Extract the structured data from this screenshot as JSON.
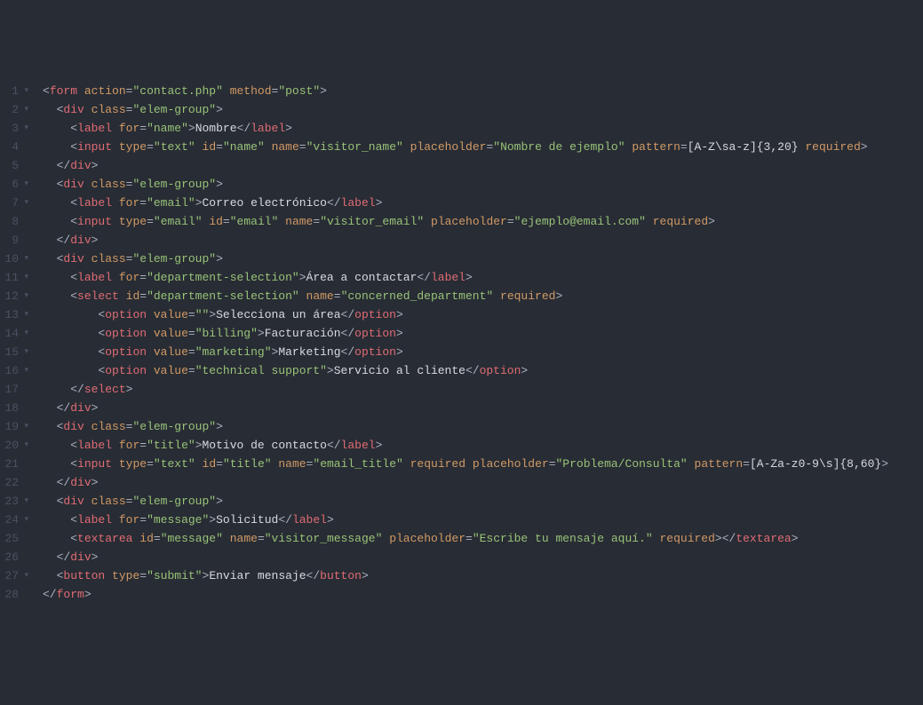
{
  "lines": [
    {
      "n": "1",
      "fold": true,
      "indent": 0,
      "tokens": [
        [
          "p",
          "<"
        ],
        [
          "t",
          "form"
        ],
        [
          "p",
          " "
        ],
        [
          "a",
          "action"
        ],
        [
          "p",
          "="
        ],
        [
          "s",
          "\"contact.php\""
        ],
        [
          "p",
          " "
        ],
        [
          "a",
          "method"
        ],
        [
          "p",
          "="
        ],
        [
          "s",
          "\"post\""
        ],
        [
          "p",
          ">"
        ]
      ]
    },
    {
      "n": "2",
      "fold": true,
      "indent": 1,
      "tokens": [
        [
          "p",
          "<"
        ],
        [
          "t",
          "div"
        ],
        [
          "p",
          " "
        ],
        [
          "a",
          "class"
        ],
        [
          "p",
          "="
        ],
        [
          "s",
          "\"elem-group\""
        ],
        [
          "p",
          ">"
        ]
      ]
    },
    {
      "n": "3",
      "fold": true,
      "indent": 2,
      "tokens": [
        [
          "p",
          "<"
        ],
        [
          "t",
          "label"
        ],
        [
          "p",
          " "
        ],
        [
          "a",
          "for"
        ],
        [
          "p",
          "="
        ],
        [
          "s",
          "\"name\""
        ],
        [
          "p",
          ">"
        ],
        [
          "tx",
          "Nombre"
        ],
        [
          "p",
          "</"
        ],
        [
          "t",
          "label"
        ],
        [
          "p",
          ">"
        ]
      ]
    },
    {
      "n": "4",
      "fold": false,
      "indent": 2,
      "tokens": [
        [
          "p",
          "<"
        ],
        [
          "t",
          "input"
        ],
        [
          "p",
          " "
        ],
        [
          "a",
          "type"
        ],
        [
          "p",
          "="
        ],
        [
          "s",
          "\"text\""
        ],
        [
          "p",
          " "
        ],
        [
          "a",
          "id"
        ],
        [
          "p",
          "="
        ],
        [
          "s",
          "\"name\""
        ],
        [
          "p",
          " "
        ],
        [
          "a",
          "name"
        ],
        [
          "p",
          "="
        ],
        [
          "s",
          "\"visitor_name\""
        ],
        [
          "p",
          " "
        ],
        [
          "a",
          "placeholder"
        ],
        [
          "p",
          "="
        ],
        [
          "s",
          "\"Nombre de ejemplo\""
        ],
        [
          "p",
          " "
        ],
        [
          "a",
          "pattern"
        ],
        [
          "p",
          "="
        ],
        [
          "tx",
          "[A-Z\\sa-z]{3,20}"
        ],
        [
          "p",
          " "
        ],
        [
          "a",
          "required"
        ],
        [
          "p",
          ">"
        ]
      ]
    },
    {
      "n": "5",
      "fold": false,
      "indent": 1,
      "tokens": [
        [
          "p",
          "</"
        ],
        [
          "t",
          "div"
        ],
        [
          "p",
          ">"
        ]
      ]
    },
    {
      "n": "6",
      "fold": true,
      "indent": 1,
      "tokens": [
        [
          "p",
          "<"
        ],
        [
          "t",
          "div"
        ],
        [
          "p",
          " "
        ],
        [
          "a",
          "class"
        ],
        [
          "p",
          "="
        ],
        [
          "s",
          "\"elem-group\""
        ],
        [
          "p",
          ">"
        ]
      ]
    },
    {
      "n": "7",
      "fold": true,
      "indent": 2,
      "tokens": [
        [
          "p",
          "<"
        ],
        [
          "t",
          "label"
        ],
        [
          "p",
          " "
        ],
        [
          "a",
          "for"
        ],
        [
          "p",
          "="
        ],
        [
          "s",
          "\"email\""
        ],
        [
          "p",
          ">"
        ],
        [
          "tx",
          "Correo electrónico"
        ],
        [
          "p",
          "</"
        ],
        [
          "t",
          "label"
        ],
        [
          "p",
          ">"
        ]
      ]
    },
    {
      "n": "8",
      "fold": false,
      "indent": 2,
      "tokens": [
        [
          "p",
          "<"
        ],
        [
          "t",
          "input"
        ],
        [
          "p",
          " "
        ],
        [
          "a",
          "type"
        ],
        [
          "p",
          "="
        ],
        [
          "s",
          "\"email\""
        ],
        [
          "p",
          " "
        ],
        [
          "a",
          "id"
        ],
        [
          "p",
          "="
        ],
        [
          "s",
          "\"email\""
        ],
        [
          "p",
          " "
        ],
        [
          "a",
          "name"
        ],
        [
          "p",
          "="
        ],
        [
          "s",
          "\"visitor_email\""
        ],
        [
          "p",
          " "
        ],
        [
          "a",
          "placeholder"
        ],
        [
          "p",
          "="
        ],
        [
          "s",
          "\"ejemplo@email.com\""
        ],
        [
          "p",
          " "
        ],
        [
          "a",
          "required"
        ],
        [
          "p",
          ">"
        ]
      ]
    },
    {
      "n": "9",
      "fold": false,
      "indent": 1,
      "tokens": [
        [
          "p",
          "</"
        ],
        [
          "t",
          "div"
        ],
        [
          "p",
          ">"
        ]
      ]
    },
    {
      "n": "10",
      "fold": true,
      "indent": 1,
      "tokens": [
        [
          "p",
          "<"
        ],
        [
          "t",
          "div"
        ],
        [
          "p",
          " "
        ],
        [
          "a",
          "class"
        ],
        [
          "p",
          "="
        ],
        [
          "s",
          "\"elem-group\""
        ],
        [
          "p",
          ">"
        ]
      ]
    },
    {
      "n": "11",
      "fold": true,
      "indent": 2,
      "tokens": [
        [
          "p",
          "<"
        ],
        [
          "t",
          "label"
        ],
        [
          "p",
          " "
        ],
        [
          "a",
          "for"
        ],
        [
          "p",
          "="
        ],
        [
          "s",
          "\"department-selection\""
        ],
        [
          "p",
          ">"
        ],
        [
          "tx",
          "Área a contactar"
        ],
        [
          "p",
          "</"
        ],
        [
          "t",
          "label"
        ],
        [
          "p",
          ">"
        ]
      ]
    },
    {
      "n": "12",
      "fold": true,
      "indent": 2,
      "tokens": [
        [
          "p",
          "<"
        ],
        [
          "t",
          "select"
        ],
        [
          "p",
          " "
        ],
        [
          "a",
          "id"
        ],
        [
          "p",
          "="
        ],
        [
          "s",
          "\"department-selection\""
        ],
        [
          "p",
          " "
        ],
        [
          "a",
          "name"
        ],
        [
          "p",
          "="
        ],
        [
          "s",
          "\"concerned_department\""
        ],
        [
          "p",
          " "
        ],
        [
          "a",
          "required"
        ],
        [
          "p",
          ">"
        ]
      ]
    },
    {
      "n": "13",
      "fold": true,
      "indent": 4,
      "tokens": [
        [
          "p",
          "<"
        ],
        [
          "t",
          "option"
        ],
        [
          "p",
          " "
        ],
        [
          "a",
          "value"
        ],
        [
          "p",
          "="
        ],
        [
          "s",
          "\"\""
        ],
        [
          "p",
          ">"
        ],
        [
          "tx",
          "Selecciona un área"
        ],
        [
          "p",
          "</"
        ],
        [
          "t",
          "option"
        ],
        [
          "p",
          ">"
        ]
      ]
    },
    {
      "n": "14",
      "fold": true,
      "indent": 4,
      "tokens": [
        [
          "p",
          "<"
        ],
        [
          "t",
          "option"
        ],
        [
          "p",
          " "
        ],
        [
          "a",
          "value"
        ],
        [
          "p",
          "="
        ],
        [
          "s",
          "\"billing\""
        ],
        [
          "p",
          ">"
        ],
        [
          "tx",
          "Facturación"
        ],
        [
          "p",
          "</"
        ],
        [
          "t",
          "option"
        ],
        [
          "p",
          ">"
        ]
      ]
    },
    {
      "n": "15",
      "fold": true,
      "indent": 4,
      "tokens": [
        [
          "p",
          "<"
        ],
        [
          "t",
          "option"
        ],
        [
          "p",
          " "
        ],
        [
          "a",
          "value"
        ],
        [
          "p",
          "="
        ],
        [
          "s",
          "\"marketing\""
        ],
        [
          "p",
          ">"
        ],
        [
          "tx",
          "Marketing"
        ],
        [
          "p",
          "</"
        ],
        [
          "t",
          "option"
        ],
        [
          "p",
          ">"
        ]
      ]
    },
    {
      "n": "16",
      "fold": true,
      "indent": 4,
      "tokens": [
        [
          "p",
          "<"
        ],
        [
          "t",
          "option"
        ],
        [
          "p",
          " "
        ],
        [
          "a",
          "value"
        ],
        [
          "p",
          "="
        ],
        [
          "s",
          "\"technical support\""
        ],
        [
          "p",
          ">"
        ],
        [
          "tx",
          "Servicio al cliente"
        ],
        [
          "p",
          "</"
        ],
        [
          "t",
          "option"
        ],
        [
          "p",
          ">"
        ]
      ]
    },
    {
      "n": "17",
      "fold": false,
      "indent": 2,
      "tokens": [
        [
          "p",
          "</"
        ],
        [
          "t",
          "select"
        ],
        [
          "p",
          ">"
        ]
      ]
    },
    {
      "n": "18",
      "fold": false,
      "indent": 1,
      "tokens": [
        [
          "p",
          "</"
        ],
        [
          "t",
          "div"
        ],
        [
          "p",
          ">"
        ]
      ]
    },
    {
      "n": "19",
      "fold": true,
      "indent": 1,
      "tokens": [
        [
          "p",
          "<"
        ],
        [
          "t",
          "div"
        ],
        [
          "p",
          " "
        ],
        [
          "a",
          "class"
        ],
        [
          "p",
          "="
        ],
        [
          "s",
          "\"elem-group\""
        ],
        [
          "p",
          ">"
        ]
      ]
    },
    {
      "n": "20",
      "fold": true,
      "indent": 2,
      "tokens": [
        [
          "p",
          "<"
        ],
        [
          "t",
          "label"
        ],
        [
          "p",
          " "
        ],
        [
          "a",
          "for"
        ],
        [
          "p",
          "="
        ],
        [
          "s",
          "\"title\""
        ],
        [
          "p",
          ">"
        ],
        [
          "tx",
          "Motivo de contacto"
        ],
        [
          "p",
          "</"
        ],
        [
          "t",
          "label"
        ],
        [
          "p",
          ">"
        ]
      ]
    },
    {
      "n": "21",
      "fold": false,
      "indent": 2,
      "tokens": [
        [
          "p",
          "<"
        ],
        [
          "t",
          "input"
        ],
        [
          "p",
          " "
        ],
        [
          "a",
          "type"
        ],
        [
          "p",
          "="
        ],
        [
          "s",
          "\"text\""
        ],
        [
          "p",
          " "
        ],
        [
          "a",
          "id"
        ],
        [
          "p",
          "="
        ],
        [
          "s",
          "\"title\""
        ],
        [
          "p",
          " "
        ],
        [
          "a",
          "name"
        ],
        [
          "p",
          "="
        ],
        [
          "s",
          "\"email_title\""
        ],
        [
          "p",
          " "
        ],
        [
          "a",
          "required"
        ],
        [
          "p",
          " "
        ],
        [
          "a",
          "placeholder"
        ],
        [
          "p",
          "="
        ],
        [
          "s",
          "\"Problema/Consulta\""
        ],
        [
          "p",
          " "
        ],
        [
          "a",
          "pattern"
        ],
        [
          "p",
          "="
        ],
        [
          "tx",
          "[A-Za-z0-9\\s]{8,60}"
        ],
        [
          "p",
          ">"
        ]
      ]
    },
    {
      "n": "22",
      "fold": false,
      "indent": 1,
      "tokens": [
        [
          "p",
          "</"
        ],
        [
          "t",
          "div"
        ],
        [
          "p",
          ">"
        ]
      ]
    },
    {
      "n": "23",
      "fold": true,
      "indent": 1,
      "tokens": [
        [
          "p",
          "<"
        ],
        [
          "t",
          "div"
        ],
        [
          "p",
          " "
        ],
        [
          "a",
          "class"
        ],
        [
          "p",
          "="
        ],
        [
          "s",
          "\"elem-group\""
        ],
        [
          "p",
          ">"
        ]
      ]
    },
    {
      "n": "24",
      "fold": true,
      "indent": 2,
      "tokens": [
        [
          "p",
          "<"
        ],
        [
          "t",
          "label"
        ],
        [
          "p",
          " "
        ],
        [
          "a",
          "for"
        ],
        [
          "p",
          "="
        ],
        [
          "s",
          "\"message\""
        ],
        [
          "p",
          ">"
        ],
        [
          "tx",
          "Solicitud"
        ],
        [
          "p",
          "</"
        ],
        [
          "t",
          "label"
        ],
        [
          "p",
          ">"
        ]
      ]
    },
    {
      "n": "25",
      "fold": false,
      "indent": 2,
      "tokens": [
        [
          "p",
          "<"
        ],
        [
          "t",
          "textarea"
        ],
        [
          "p",
          " "
        ],
        [
          "a",
          "id"
        ],
        [
          "p",
          "="
        ],
        [
          "s",
          "\"message\""
        ],
        [
          "p",
          " "
        ],
        [
          "a",
          "name"
        ],
        [
          "p",
          "="
        ],
        [
          "s",
          "\"visitor_message\""
        ],
        [
          "p",
          " "
        ],
        [
          "a",
          "placeholder"
        ],
        [
          "p",
          "="
        ],
        [
          "s",
          "\"Escribe tu mensaje aquí.\""
        ],
        [
          "p",
          " "
        ],
        [
          "a",
          "required"
        ],
        [
          "p",
          ">"
        ],
        [
          "p",
          "</"
        ],
        [
          "t",
          "textarea"
        ],
        [
          "p",
          ">"
        ]
      ]
    },
    {
      "n": "26",
      "fold": false,
      "indent": 1,
      "tokens": [
        [
          "p",
          "</"
        ],
        [
          "t",
          "div"
        ],
        [
          "p",
          ">"
        ]
      ]
    },
    {
      "n": "27",
      "fold": true,
      "indent": 1,
      "tokens": [
        [
          "p",
          "<"
        ],
        [
          "t",
          "button"
        ],
        [
          "p",
          " "
        ],
        [
          "a",
          "type"
        ],
        [
          "p",
          "="
        ],
        [
          "s",
          "\"submit\""
        ],
        [
          "p",
          ">"
        ],
        [
          "tx",
          "Enviar mensaje"
        ],
        [
          "p",
          "</"
        ],
        [
          "t",
          "button"
        ],
        [
          "p",
          ">"
        ]
      ]
    },
    {
      "n": "28",
      "fold": false,
      "indent": 0,
      "tokens": [
        [
          "p",
          "</"
        ],
        [
          "t",
          "form"
        ],
        [
          "p",
          ">"
        ]
      ]
    }
  ]
}
